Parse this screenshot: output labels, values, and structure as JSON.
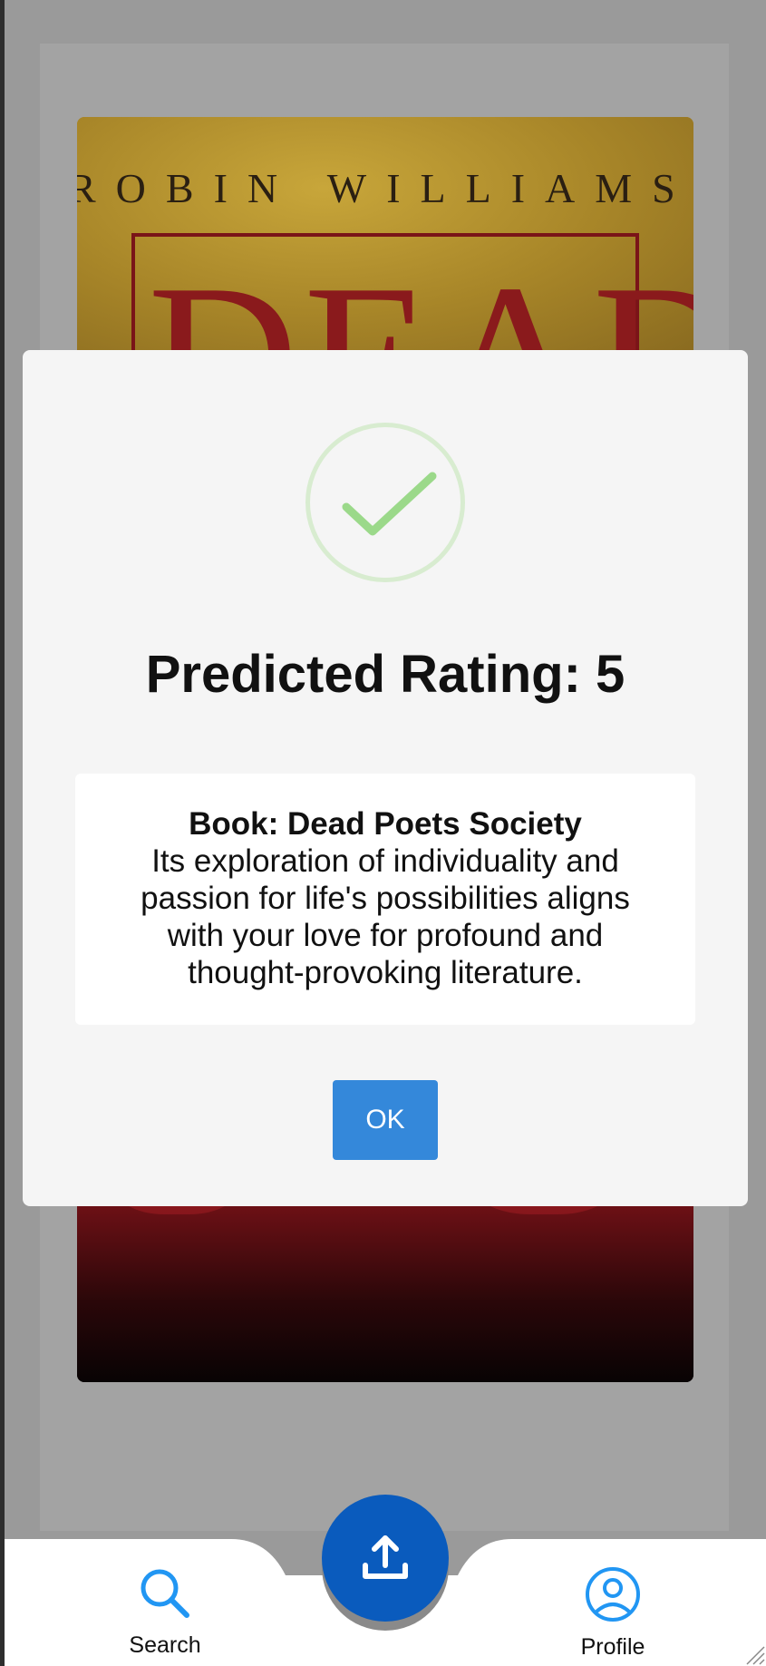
{
  "background_book_cover": {
    "author_text": "ROBIN WILLIAMS",
    "title_text": "DEAD"
  },
  "modal": {
    "title": "Predicted Rating: 5",
    "book_line": "Book: Dead Poets Society",
    "message": "Its exploration of individuality and passion for life's possibilities aligns with your love for profound and thought-provoking literature.",
    "ok_label": "OK",
    "icon": "success-check-icon",
    "icon_color": "#9bd98a"
  },
  "bottom_nav": {
    "search_label": "Search",
    "profile_label": "Profile",
    "upload_icon": "upload-icon",
    "accent_color": "#2196f3",
    "fab_color": "#0a5bbd"
  }
}
